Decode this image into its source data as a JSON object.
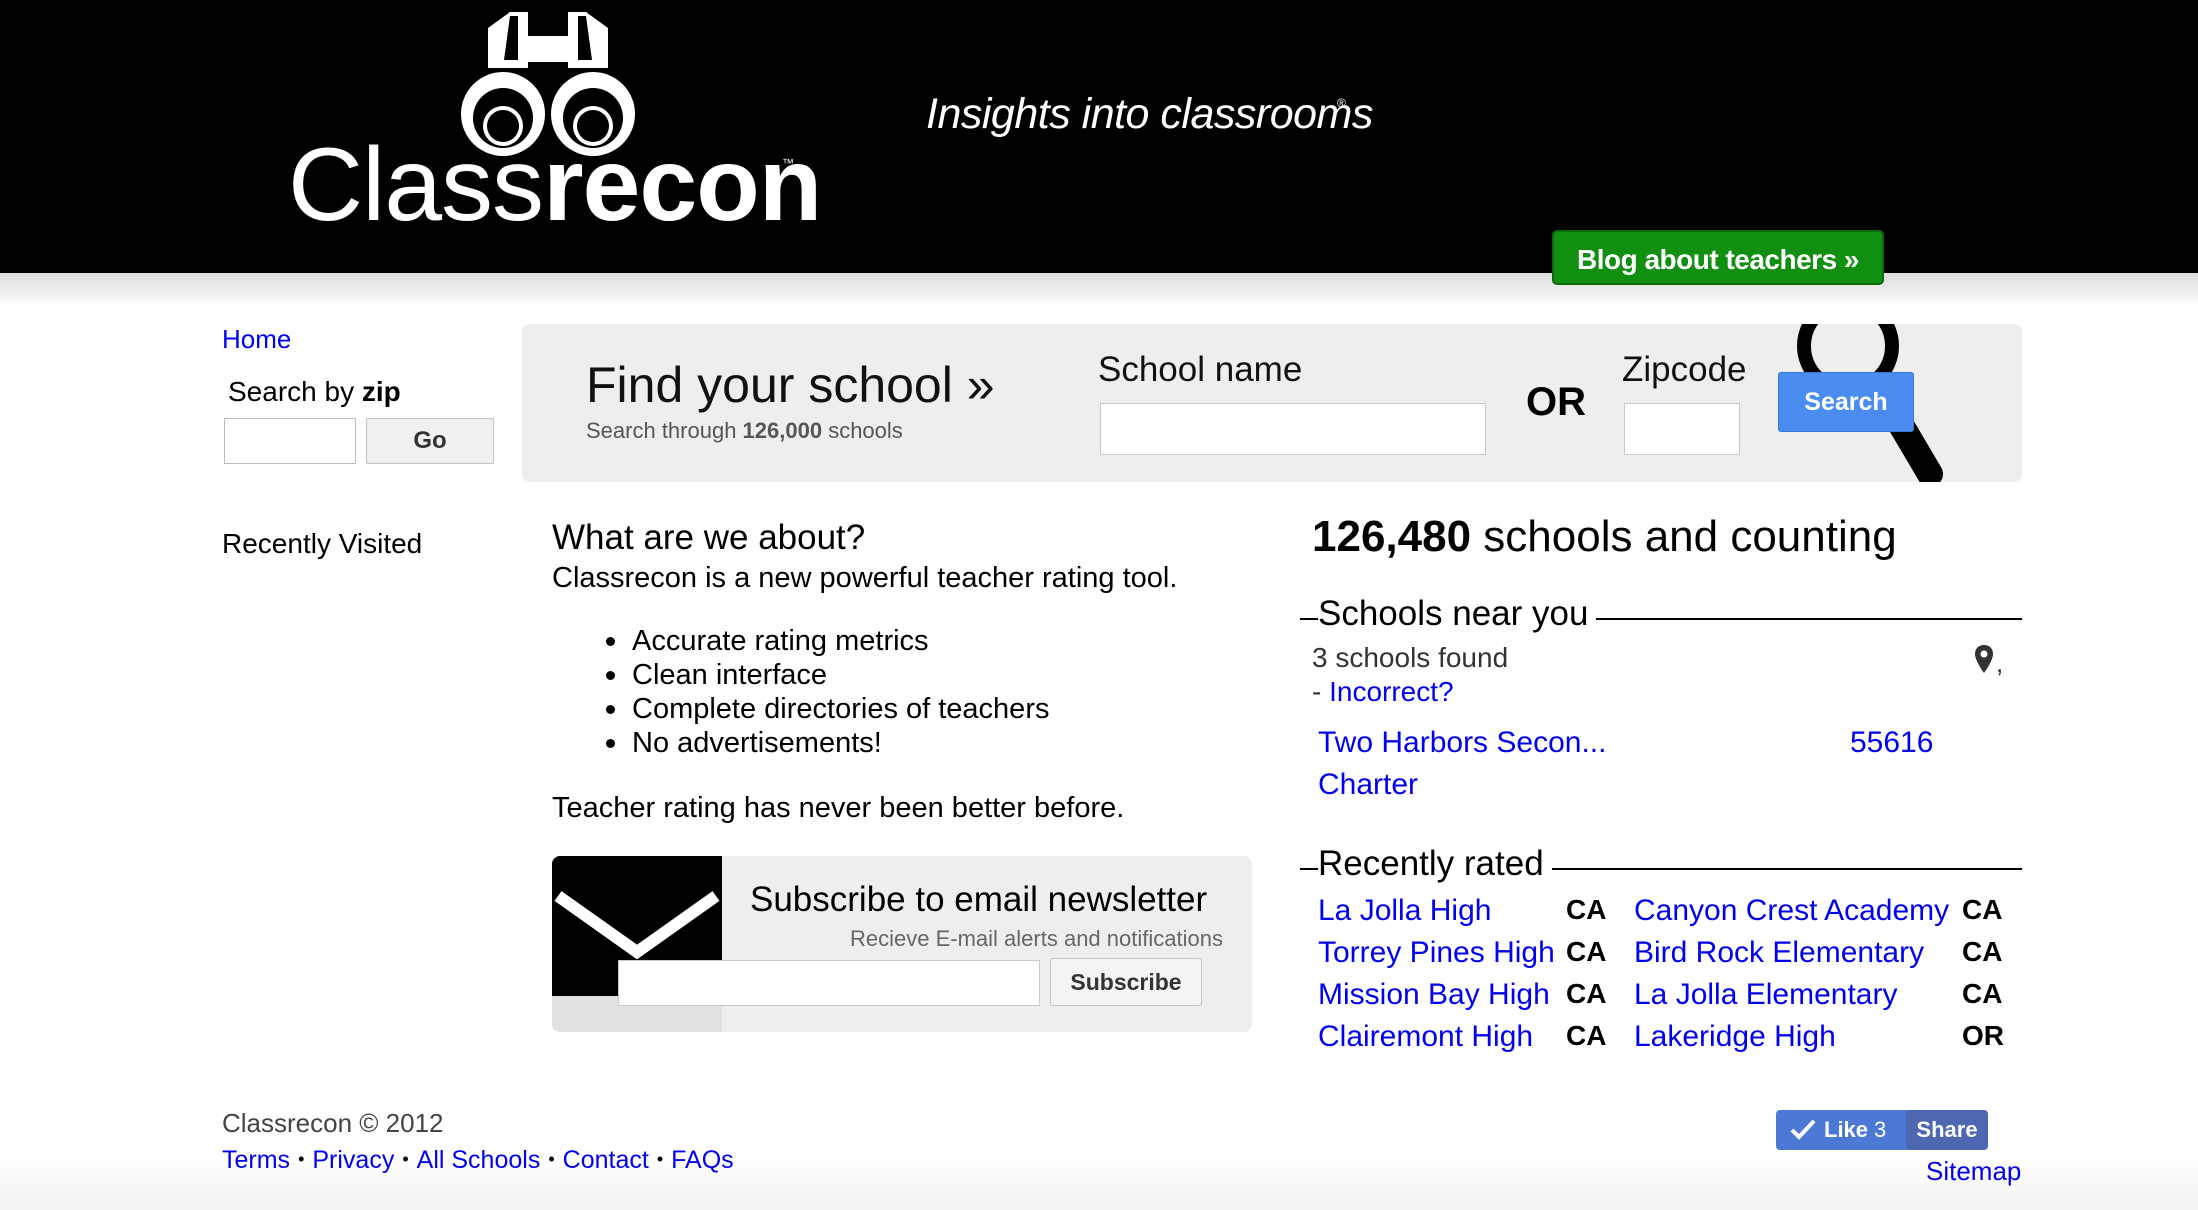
{
  "header": {
    "logo_light": "Class",
    "logo_bold": "recon",
    "logo_tm": "™",
    "tagline": "Insights into classrooms",
    "tagline_mark": "®",
    "blog_button": "Blog about teachers »"
  },
  "sidebar": {
    "home": "Home",
    "search_by": "Search by ",
    "search_by_bold": "zip",
    "zip_value": "",
    "go_button": "Go",
    "recently_visited": "Recently Visited"
  },
  "find": {
    "title": "Find your school »",
    "sub_prefix": "Search through ",
    "sub_count": "126,000",
    "sub_suffix": " schools",
    "school_label": "School name",
    "school_value": "",
    "or": "OR",
    "zip_label": "Zipcode",
    "zip_value": "",
    "search_button": "Search"
  },
  "about": {
    "title": "What are we about?",
    "description": "Classrecon is a new powerful teacher rating tool.",
    "points": [
      "Accurate rating metrics",
      "Clean interface",
      "Complete directories of teachers",
      "No advertisements!"
    ],
    "footer": "Teacher rating has never been better before."
  },
  "subscribe": {
    "title": "Subscribe to email newsletter",
    "subtitle": "Recieve E-mail alerts and notifications",
    "email_value": "",
    "button": "Subscribe"
  },
  "stats": {
    "count": "126,480",
    "suffix": " schools and counting"
  },
  "near": {
    "heading": "Schools near you",
    "found": "3 schools found",
    "comma": ",",
    "incorrect_prefix": "- ",
    "incorrect_link": "Incorrect?",
    "school_name": "Two Harbors Secon...",
    "school_zip": "55616",
    "school_type": "Charter"
  },
  "rated": {
    "heading": "Recently rated",
    "rows": [
      {
        "name1": "La Jolla High",
        "state1": "CA",
        "name2": "Canyon Crest Academy",
        "state2": "CA"
      },
      {
        "name1": "Torrey Pines High",
        "state1": "CA",
        "name2": "Bird Rock Elementary",
        "state2": "CA"
      },
      {
        "name1": "Mission Bay High",
        "state1": "CA",
        "name2": "La Jolla Elementary",
        "state2": "CA"
      },
      {
        "name1": "Clairemont High",
        "state1": "CA",
        "name2": "Lakeridge High",
        "state2": "OR"
      }
    ]
  },
  "footer": {
    "copyright": "Classrecon © 2012",
    "links": [
      "Terms",
      "Privacy",
      "All Schools",
      "Contact",
      "FAQs"
    ],
    "separator": "•",
    "like_label": "Like",
    "like_count": "3",
    "share_label": "Share",
    "sitemap": "Sitemap"
  },
  "colors": {
    "link": "#0000ee",
    "blog_green": "#118f11",
    "search_blue": "#4a8cf0",
    "facebook_blue": "#4d79d6"
  }
}
